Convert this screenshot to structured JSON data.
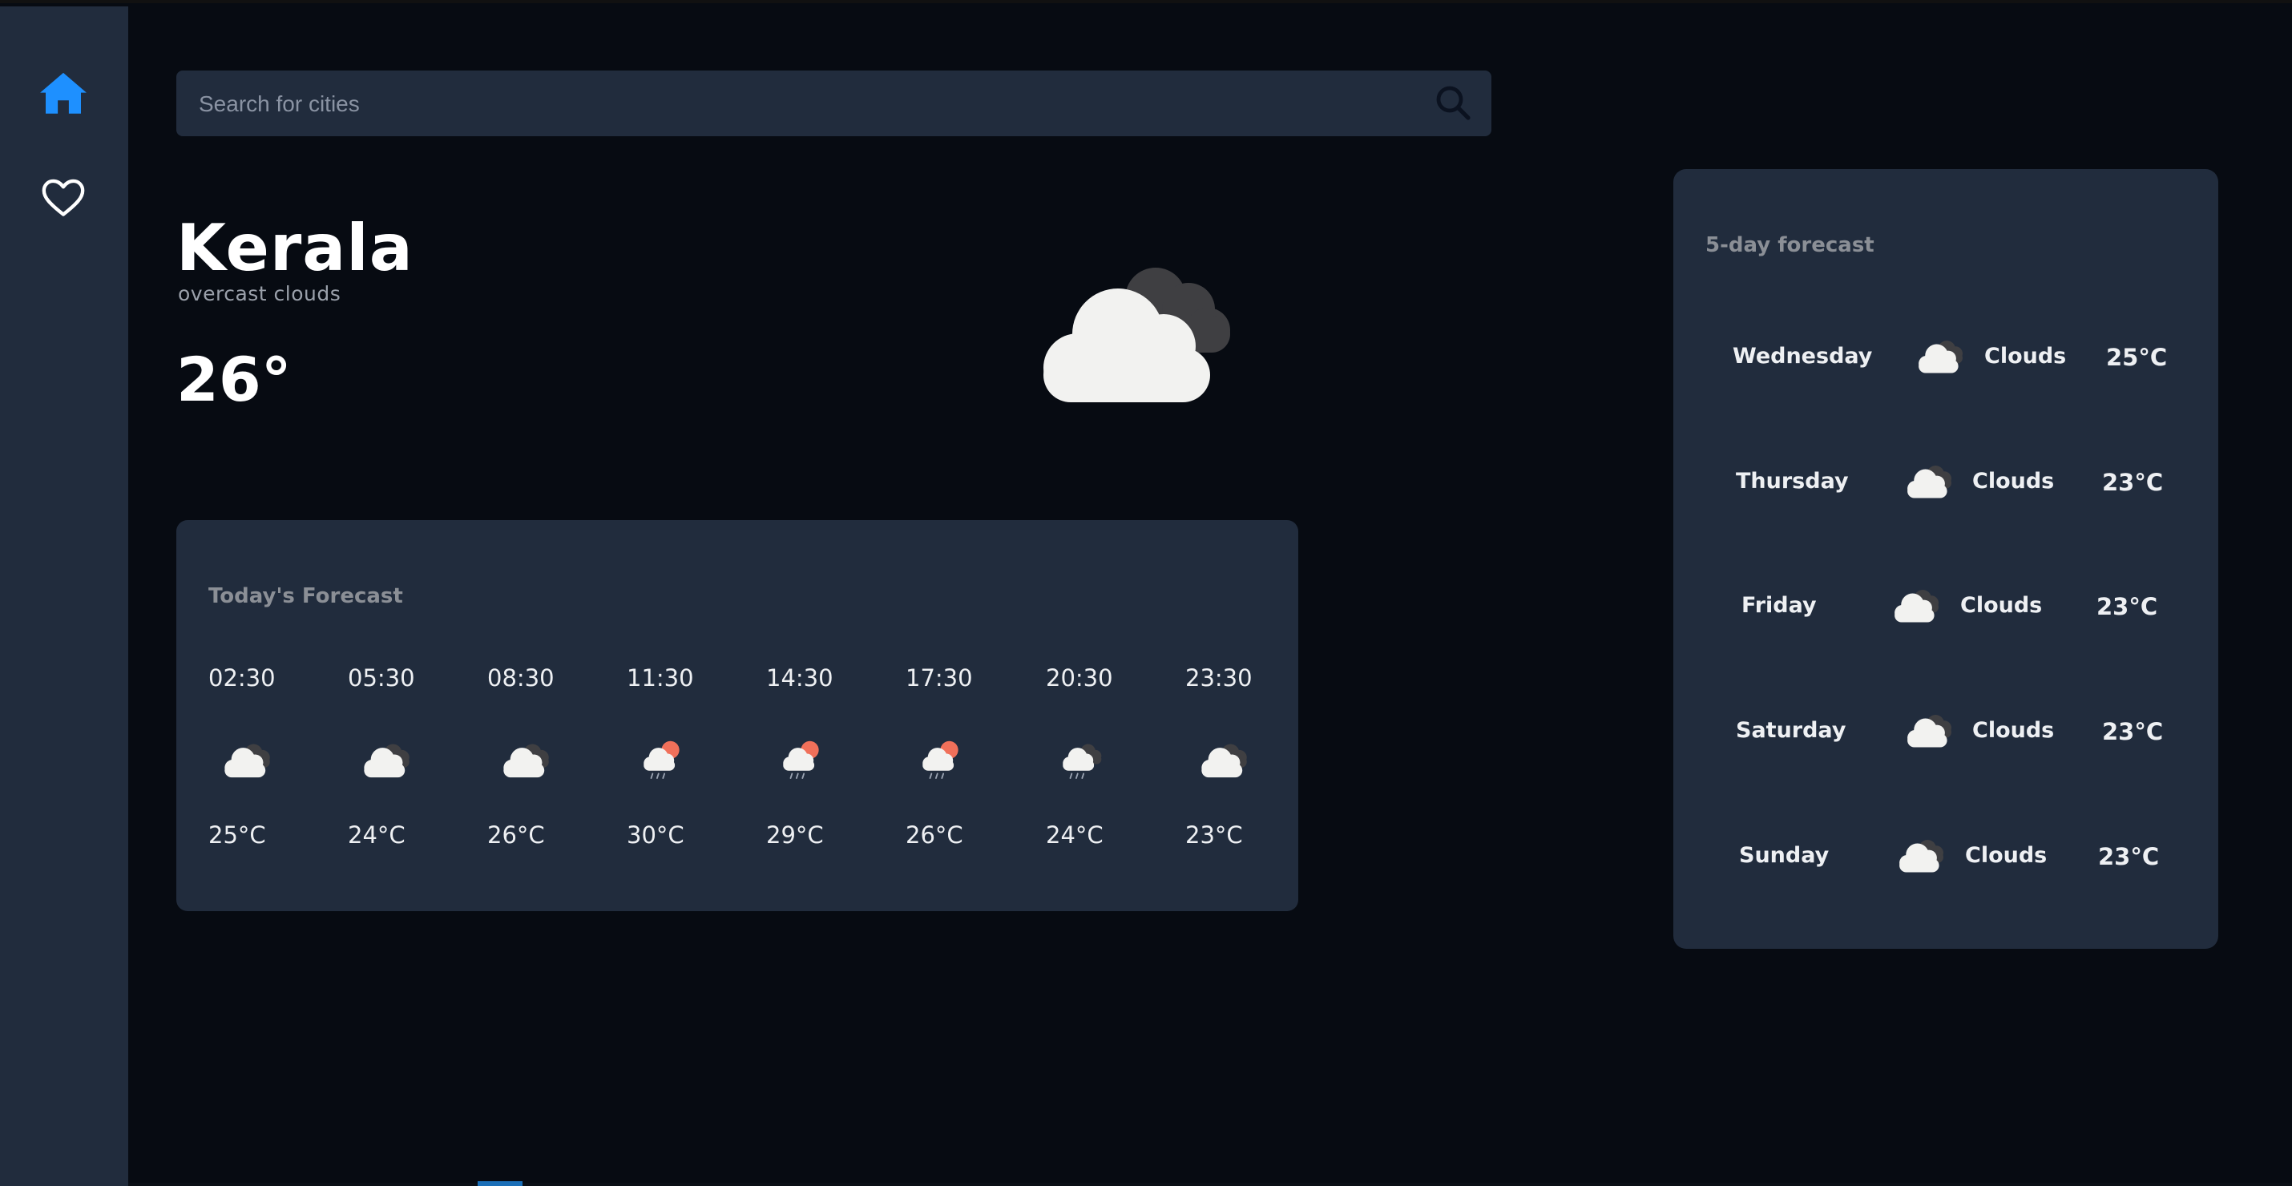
{
  "colors": {
    "background": "#070b12",
    "panel": "#212c3d",
    "accent": "#1e90ff",
    "muted_text": "#8b8f96",
    "sun": "#f0705a"
  },
  "sidebar": {
    "items": [
      {
        "name": "home",
        "icon": "home-icon",
        "active": true
      },
      {
        "name": "favorites",
        "icon": "heart-icon",
        "active": false
      }
    ]
  },
  "search": {
    "placeholder": "Search for cities",
    "value": "",
    "icon": "search-icon"
  },
  "current": {
    "city": "Kerala",
    "description": "overcast clouds",
    "temperature": "26°",
    "icon": "overcast-clouds-icon"
  },
  "today": {
    "title": "Today's Forecast",
    "hours": [
      {
        "time": "02:30",
        "temp": "25°C",
        "icon": "clouds-icon"
      },
      {
        "time": "05:30",
        "temp": "24°C",
        "icon": "clouds-icon"
      },
      {
        "time": "08:30",
        "temp": "26°C",
        "icon": "clouds-icon"
      },
      {
        "time": "11:30",
        "temp": "30°C",
        "icon": "sun-rain-icon"
      },
      {
        "time": "14:30",
        "temp": "29°C",
        "icon": "sun-rain-icon"
      },
      {
        "time": "17:30",
        "temp": "26°C",
        "icon": "sun-rain-icon"
      },
      {
        "time": "20:30",
        "temp": "24°C",
        "icon": "cloud-rain-icon"
      },
      {
        "time": "23:30",
        "temp": "23°C",
        "icon": "clouds-icon"
      }
    ]
  },
  "fiveday": {
    "title": "5-day forecast",
    "days": [
      {
        "day": "Wednesday",
        "condition": "Clouds",
        "temp": "25°C",
        "icon": "clouds-icon"
      },
      {
        "day": "Thursday",
        "condition": "Clouds",
        "temp": "23°C",
        "icon": "clouds-icon"
      },
      {
        "day": "Friday",
        "condition": "Clouds",
        "temp": "23°C",
        "icon": "clouds-icon"
      },
      {
        "day": "Saturday",
        "condition": "Clouds",
        "temp": "23°C",
        "icon": "clouds-icon"
      },
      {
        "day": "Sunday",
        "condition": "Clouds",
        "temp": "23°C",
        "icon": "clouds-icon"
      }
    ]
  }
}
